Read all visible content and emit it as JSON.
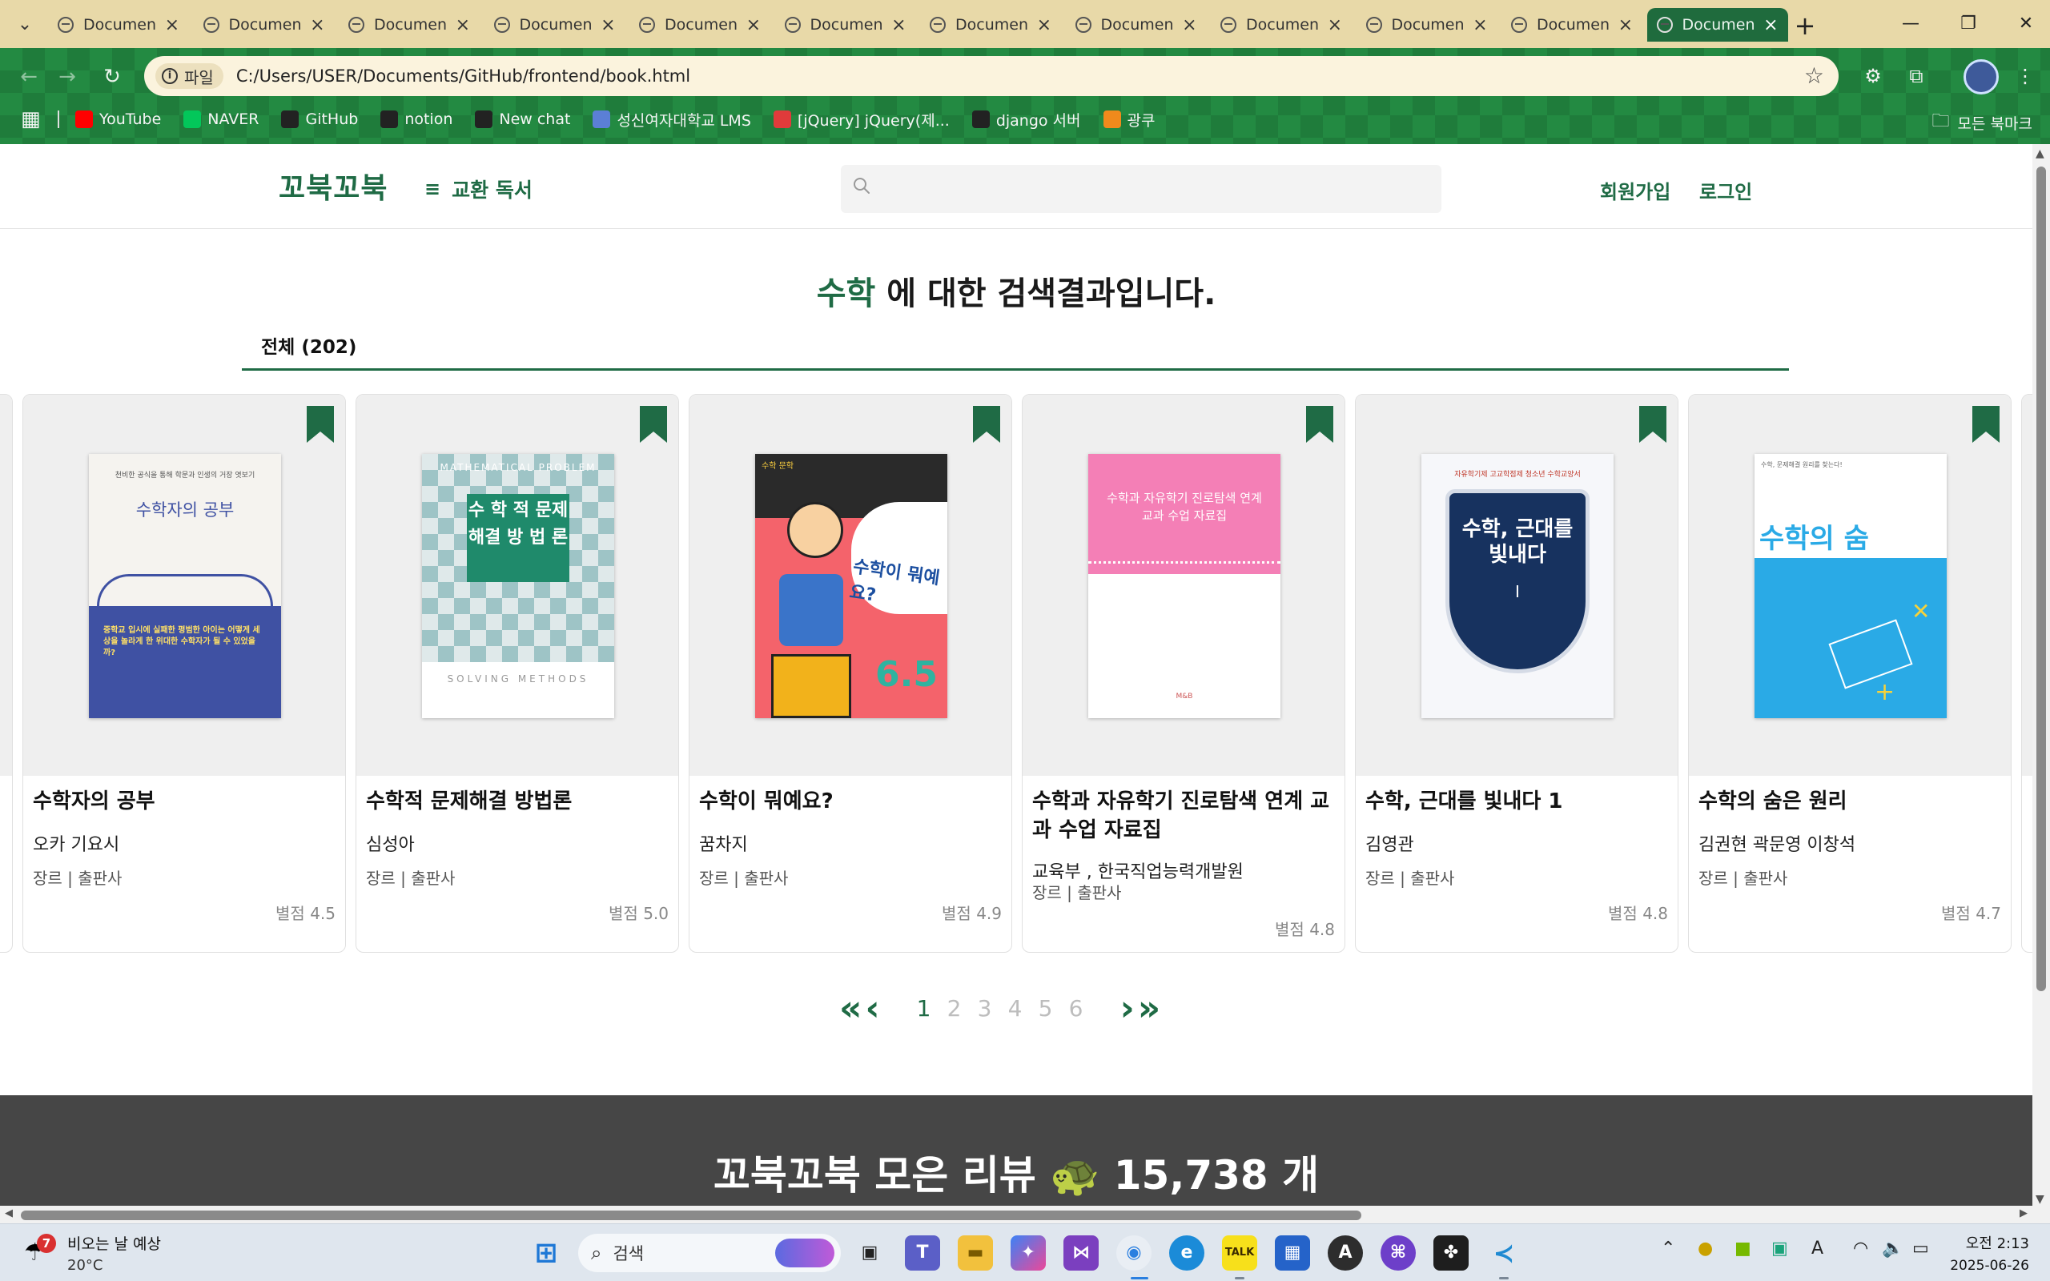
{
  "browser": {
    "tabs": [
      {
        "label": "Documen",
        "active": false
      },
      {
        "label": "Documen",
        "active": false
      },
      {
        "label": "Documen",
        "active": false
      },
      {
        "label": "Documen",
        "active": false
      },
      {
        "label": "Documen",
        "active": false
      },
      {
        "label": "Documen",
        "active": false
      },
      {
        "label": "Documen",
        "active": false
      },
      {
        "label": "Documen",
        "active": false
      },
      {
        "label": "Documen",
        "active": false
      },
      {
        "label": "Documen",
        "active": false
      },
      {
        "label": "Documen",
        "active": false
      },
      {
        "label": "Documen",
        "active": true
      }
    ],
    "site_info_label": "파일",
    "url": "C:/Users/USER/Documents/GitHub/frontend/book.html",
    "bookmarks": [
      {
        "label": "YouTube",
        "icon": "youtube-icon",
        "color": "#ff0000"
      },
      {
        "label": "NAVER",
        "icon": "naver-icon",
        "color": "#03c75a"
      },
      {
        "label": "GitHub",
        "icon": "github-icon",
        "color": "#222222"
      },
      {
        "label": "notion",
        "icon": "notion-icon",
        "color": "#222222"
      },
      {
        "label": "New chat",
        "icon": "chatgpt-icon",
        "color": "#222222"
      },
      {
        "label": "성신여자대학교 LMS",
        "icon": "globe-icon",
        "color": "#5b7fd6"
      },
      {
        "label": "[jQuery] jQuery(제...",
        "icon": "site-icon",
        "color": "#e03b3b"
      },
      {
        "label": "django 서버",
        "icon": "github-icon",
        "color": "#222222"
      },
      {
        "label": "광쿠",
        "icon": "site-icon",
        "color": "#f08a1c"
      }
    ],
    "all_bookmarks_label": "모든 북마크"
  },
  "site": {
    "logo": "꼬북꼬북",
    "menu_label": "교환 독서",
    "search_placeholder": "",
    "signup": "회원가입",
    "login": "로그인"
  },
  "results": {
    "keyword": "수학",
    "title_suffix": " 에 대한 검색결과입니다.",
    "filter_tab": "전체 (202)"
  },
  "books": [
    {
      "title": "수학자의 공부",
      "author": "오카 기요시",
      "meta": "장르 | 출판사",
      "rating": "별점 4.5"
    },
    {
      "title": "수학적 문제해결 방법론",
      "author": "심성아",
      "meta": "장르 | 출판사",
      "rating": "별점 5.0"
    },
    {
      "title": "수학이 뭐예요?",
      "author": "꿈차지",
      "meta": "장르 | 출판사",
      "rating": "별점 4.9"
    },
    {
      "title": "수학과 자유학기 진로탐색 연계 교과 수업 자료집",
      "author": "교육부 , 한국직업능력개발원",
      "meta": "장르 | 출판사",
      "rating": "별점 4.8"
    },
    {
      "title": "수학, 근대를 빛내다 1",
      "author": "김영관",
      "meta": "장르 | 출판사",
      "rating": "별점 4.8"
    },
    {
      "title": "수학의 숨은 원리",
      "author": "김권현 곽문영 이창석",
      "meta": "장르 | 출판사",
      "rating": "별점 4.7"
    }
  ],
  "covers": [
    {
      "top_text": "천비한 공식을 통해 학문과 인생의 거장 엿보기",
      "big_text": "수학자의 공부",
      "bottom_text": "중학교 입시에 실패한 평범한 아이는 어떻게 세상을 놀라게 한 위대한 수학자가 될 수 있었을까?",
      "bg": "#f5f3ef",
      "accent": "#3f51a3"
    },
    {
      "top_text": "MATHEMATICAL PROBLEM",
      "big_text": "수 학 적 문제해결 방 법 론",
      "bottom_text": "SOLVING METHODS",
      "bg": "#dfe9ea",
      "accent": "#1f8a6b"
    },
    {
      "top_text": "수학 문학",
      "big_text": "수학이 뭐예요?",
      "bottom_text": "6.5",
      "bg": "#f4636b",
      "accent": "#1c4fa0"
    },
    {
      "top_text": "",
      "big_text": "수학과 자유학기 진로탐색 연계 교과 수업 자료집",
      "bottom_text": "M&B",
      "bg": "#f47fb6",
      "accent": "#ffffff"
    },
    {
      "top_text": "자유학기제 고교학점제 청소년 수학교양서",
      "big_text": "수학, 근대를 빛내다",
      "bottom_text": "I",
      "bg": "#f6f7fa",
      "accent": "#17325f"
    },
    {
      "top_text": "수학, 문제해결 원리를 찾는다!",
      "big_text": "수학의 숨은원리",
      "bottom_text": "",
      "bg": "#2aaae6",
      "accent": "#ffffff"
    }
  ],
  "pagination": {
    "first": "«",
    "prev": "‹",
    "pages": [
      "1",
      "2",
      "3",
      "4",
      "5",
      "6"
    ],
    "current": "1",
    "next": "›",
    "last": "»"
  },
  "review_band": {
    "text": "꼬북꼬북 모은 리뷰 🐢 15,738 개"
  },
  "taskbar": {
    "weather_badge": "7",
    "weather_line1": "비오는 날 예상",
    "weather_line2": "20°C",
    "search_label": "검색",
    "time": "오전 2:13",
    "date": "2025-06-26",
    "ime": "A"
  },
  "colors": {
    "brand_green": "#1f6b45",
    "chrome_green": "#238a42",
    "tab_bar": "#e8d9a8",
    "footer_dark": "#464646"
  }
}
